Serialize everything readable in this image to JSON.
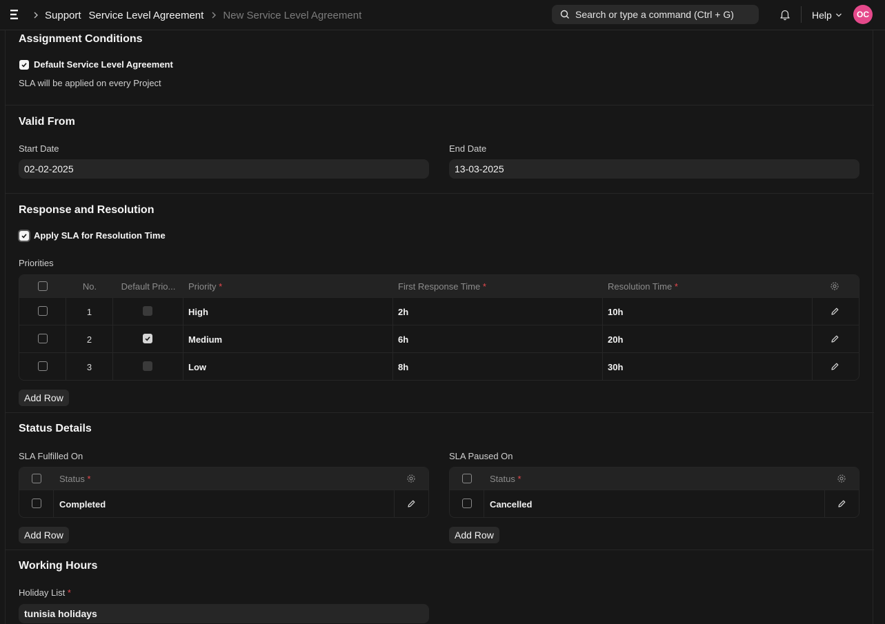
{
  "breadcrumb": [
    "Support",
    "Service Level Agreement",
    "New Service Level Agreement"
  ],
  "search": {
    "placeholder": "Search or type a command (Ctrl + G)"
  },
  "help_label": "Help",
  "user_initials": "OC",
  "assignment": {
    "title": "Assignment Conditions",
    "default_sla_label": "Default Service Level Agreement",
    "default_sla_checked": true,
    "note": "SLA will be applied on every Project"
  },
  "valid_from": {
    "title": "Valid From",
    "start_label": "Start Date",
    "start_value": "02-02-2025",
    "end_label": "End Date",
    "end_value": "13-03-2025"
  },
  "response": {
    "title": "Response and Resolution",
    "apply_label": "Apply SLA for Resolution Time",
    "apply_checked": true,
    "priorities_label": "Priorities",
    "columns": {
      "no": "No.",
      "default_priority": "Default Prio...",
      "priority": "Priority",
      "first_response": "First Response Time",
      "resolution": "Resolution Time"
    },
    "rows": [
      {
        "no": "1",
        "default": false,
        "priority": "High",
        "first_response": "2h",
        "resolution": "10h"
      },
      {
        "no": "2",
        "default": true,
        "priority": "Medium",
        "first_response": "6h",
        "resolution": "20h"
      },
      {
        "no": "3",
        "default": false,
        "priority": "Low",
        "first_response": "8h",
        "resolution": "30h"
      }
    ],
    "add_row": "Add Row"
  },
  "status": {
    "title": "Status Details",
    "fulfilled_label": "SLA Fulfilled On",
    "paused_label": "SLA Paused On",
    "status_col": "Status",
    "fulfilled_rows": [
      "Completed"
    ],
    "paused_rows": [
      "Cancelled"
    ],
    "add_row": "Add Row"
  },
  "working": {
    "title": "Working Hours",
    "holiday_label": "Holiday List",
    "holiday_value": "tunisia holidays"
  },
  "colors": {
    "accent_avatar": "#e5498b",
    "required": "#e5484d",
    "background": "#171717"
  }
}
